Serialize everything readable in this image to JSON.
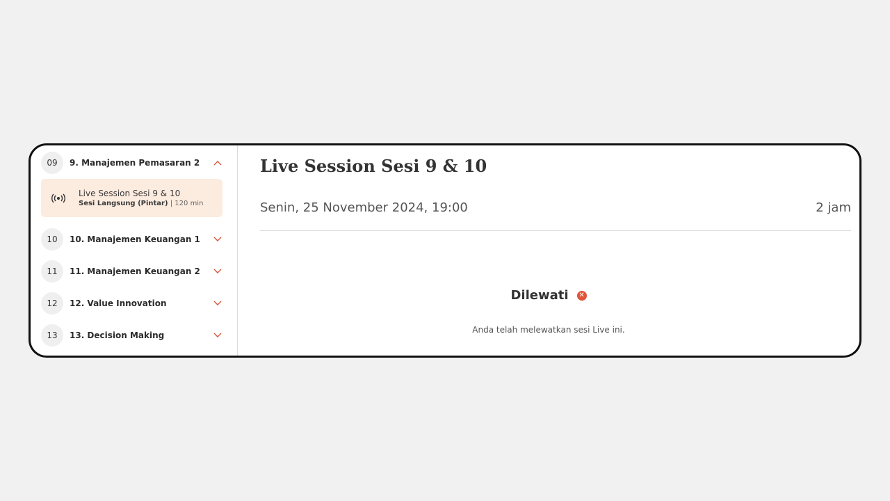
{
  "sidebar": {
    "modules": [
      {
        "number": "09",
        "title": "9. Manajemen Pemasaran 2",
        "expanded": true
      },
      {
        "number": "10",
        "title": "10. Manajemen Keuangan 1",
        "expanded": false
      },
      {
        "number": "11",
        "title": "11. Manajemen Keuangan 2",
        "expanded": false
      },
      {
        "number": "12",
        "title": "12. Value Innovation",
        "expanded": false
      },
      {
        "number": "13",
        "title": "13. Decision Making",
        "expanded": false
      }
    ],
    "active_lesson": {
      "title": "Live Session Sesi 9 & 10",
      "type": "Sesi Langsung (Pintar)",
      "duration": "| 120 min",
      "icon": "broadcast-icon"
    }
  },
  "main": {
    "title": "Live Session Sesi 9 & 10",
    "date": "Senin, 25 November 2024, 19:00",
    "duration": "2 jam",
    "status_label": "Dilewati",
    "status_icon": "close-circle-icon",
    "status_message": "Anda telah melewatkan sesi Live ini."
  },
  "colors": {
    "accent": "#e0553a",
    "active_lesson_bg": "#fcebdf",
    "page_bg": "#f1f1f1"
  }
}
